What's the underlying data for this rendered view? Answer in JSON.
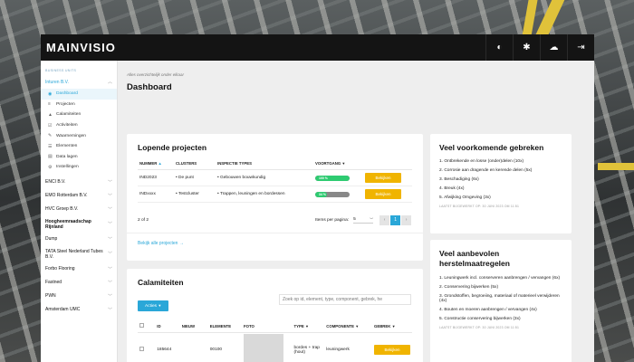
{
  "app": {
    "logo": "MAINVISIO"
  },
  "topbar": {
    "icons": [
      "contrast-icon",
      "bug-icon",
      "cloud-upload-icon",
      "logout-icon"
    ]
  },
  "sidebar": {
    "bu_label": "BUSINESS UNITS",
    "active_group": "Inturen B.V.",
    "items": [
      {
        "label": "Dashboard",
        "icon": "dashboard-icon",
        "active": true
      },
      {
        "label": "Projecten",
        "icon": "layers-icon"
      },
      {
        "label": "Calamiteiten",
        "icon": "warning-icon"
      },
      {
        "label": "Activiteiten",
        "icon": "check-icon"
      },
      {
        "label": "Waarnemingen",
        "icon": "wrench-icon"
      },
      {
        "label": "Elementen",
        "icon": "list-icon"
      },
      {
        "label": "Data lagen",
        "icon": "database-icon"
      },
      {
        "label": "Instellingen",
        "icon": "gear-icon"
      }
    ],
    "groups": [
      "ENCI B.V.",
      "EMO Rotterdam B.V.",
      "HVC Groep B.V.",
      "Hoogheemraadschap Rijnland",
      "Dump",
      "TATA Steel Nederland Tubes B.V.",
      "Forbo Flooring",
      "Fastned",
      "PWN",
      "Amsterdam UMC"
    ]
  },
  "main": {
    "breadcrumb": "Alles overzichtelijk onder elkaar",
    "title": "Dashboard"
  },
  "projects": {
    "title": "Lopende projecten",
    "columns": [
      "NUMMER",
      "CLUSTERS",
      "INSPECTIE TYPES",
      "VOORTGANG"
    ],
    "rows": [
      {
        "number": "IND2023",
        "cluster": "De punt",
        "type": "Gebouwen bouwkundig",
        "progress": 100,
        "progress_label": "100 %",
        "button": "Bekijken"
      },
      {
        "number": "INDxxxx",
        "cluster": "Testcluster",
        "type": "Trappen, leuningen en bordessen",
        "progress": 34,
        "progress_label": "34 %",
        "button": "Bekijken"
      }
    ],
    "page_info": "2 of 2",
    "per_page_label": "Items per pagina:",
    "per_page_value": "5",
    "current_page": "1",
    "link": "Bekijk alle projecten"
  },
  "defects": {
    "title": "Veel voorkomende gebreken",
    "items": [
      "1. Ontbrekende en losse (onder)delen (10x)",
      "2. Corrosie aan dragende en kerende delen (5x)",
      "3. Beschadiging (6x)",
      "4. Breuk (4x)",
      "5. Afwijking Omgeving (3x)"
    ],
    "updated": "LAATST BIJGEWERKT OP: 30 JUNI 2023 OM 11:51"
  },
  "recommended": {
    "title": "Veel aanbevolen herstelmaatregelen",
    "items": [
      "1. Leuningwerk incl. conserveren aanbrengen / vervangen (6x)",
      "2. Conservering bijwerken (5x)",
      "3. Grondstoffen, begroeiing, materiaal of materieel verwijderen (4x)",
      "4. Bouten en moeren aanbrengen / vervangen (4x)",
      "5. Constructie conservering bijwerken (3x)"
    ],
    "updated": "LAATST BIJGEWERKT OP: 30 JUNI 2023 OM 11:51"
  },
  "calamities": {
    "title": "Calamiteiten",
    "actions_label": "Acties",
    "search_placeholder": "Zoek op id, element, type, component, gebrek, he",
    "columns": [
      "ID",
      "NIEUW",
      "ELEMENTE",
      "FOTO",
      "TYPE",
      "COMPONENTE",
      "GEBREK"
    ],
    "row": {
      "id": "185644",
      "element": "00100",
      "type": "bordes + trap (hout)",
      "component": "leuningwerk",
      "button": "Bekijken"
    }
  }
}
